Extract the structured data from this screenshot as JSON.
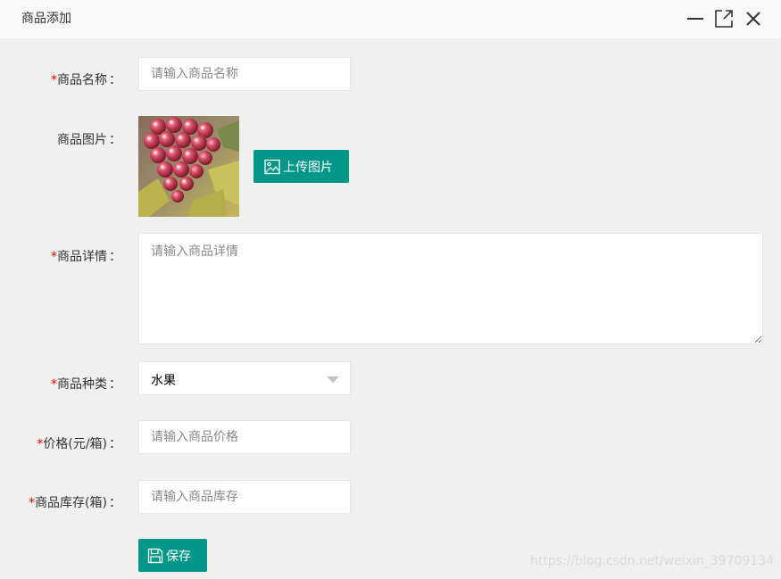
{
  "window": {
    "title": "商品添加"
  },
  "form": {
    "name": {
      "required": "*",
      "label": "商品名称",
      "colon": "：",
      "placeholder": "请输入商品名称",
      "value": ""
    },
    "image": {
      "label": "商品图片",
      "colon": "：",
      "upload_label": "上传图片"
    },
    "detail": {
      "required": "*",
      "label": "商品详情",
      "colon": "：",
      "placeholder": "请输入商品详情",
      "value": ""
    },
    "category": {
      "required": "*",
      "label": "商品种类",
      "colon": "：",
      "selected": "水果"
    },
    "price": {
      "required": "*",
      "label": "价格(元/箱)",
      "colon": "：",
      "placeholder": "请输入商品价格",
      "value": ""
    },
    "stock": {
      "required": "*",
      "label": "商品库存(箱)",
      "colon": "：",
      "placeholder": "请输入商品库存",
      "value": ""
    },
    "save_label": "保存"
  },
  "icons": {
    "minimize": "minimize-icon",
    "maximize": "maximize-icon",
    "close": "close-icon",
    "upload": "image-icon",
    "save": "save-icon"
  },
  "colors": {
    "primary": "#009688",
    "required": "#ff0000",
    "background": "#f0f0f0"
  },
  "watermark": "https://blog.csdn.net/weixin_39709134"
}
